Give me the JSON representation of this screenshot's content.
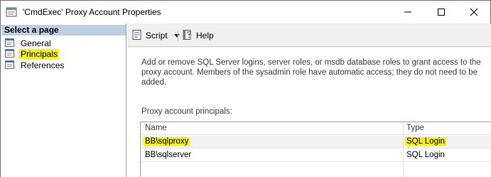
{
  "window": {
    "title": "'CmdExec' Proxy Account Properties",
    "app_icon": "properties-window-icon",
    "controls": [
      "minimize-icon",
      "maximize-icon",
      "close-icon"
    ]
  },
  "nav": {
    "header": "Select a page",
    "items": [
      {
        "label": "General",
        "icon": "page-icon",
        "selected": false
      },
      {
        "label": "Principals",
        "icon": "page-icon",
        "selected": true
      },
      {
        "label": "References",
        "icon": "page-icon",
        "selected": false
      }
    ]
  },
  "toolbar": {
    "script_label": "Script",
    "help_label": "Help"
  },
  "content": {
    "description": "Add or remove SQL Server logins, server roles, or msdb database roles to grant access to the proxy account. Members of the sysadmin role have automatic access; they do not need to be added.",
    "grid_label": "Proxy account principals:",
    "columns": [
      "Name",
      "Type"
    ],
    "rows": [
      {
        "name": "BB\\sqlproxy",
        "type": "SQL Login",
        "highlighted": true
      },
      {
        "name": "BB\\sqlserver",
        "type": "SQL Login",
        "highlighted": false
      }
    ]
  },
  "colors": {
    "highlight": "#f5f01c",
    "header_bg": "#bfcfe3",
    "pane_bg": "#f0f0f0"
  }
}
